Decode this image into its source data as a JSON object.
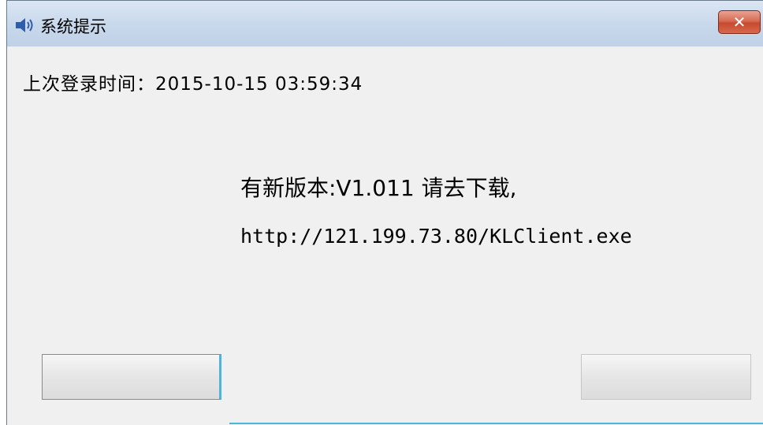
{
  "window": {
    "title": "系统提示",
    "close_label": "✕"
  },
  "messages": {
    "last_login": "上次登录时间：2015-10-15 03:59:34",
    "line2": "",
    "new_version": "有新版本:V1.011 请去下载,",
    "download_url": "http://121.199.73.80/KLClient.exe"
  },
  "buttons": {
    "left_label": "",
    "right_label": ""
  },
  "colors": {
    "titlebar": "#c9d9ec",
    "close_button": "#c74a2e",
    "background": "#f0f0f0",
    "accent": "#4bb6d9"
  },
  "icons": {
    "title_icon": "speaker-icon",
    "close_icon": "close-icon"
  }
}
